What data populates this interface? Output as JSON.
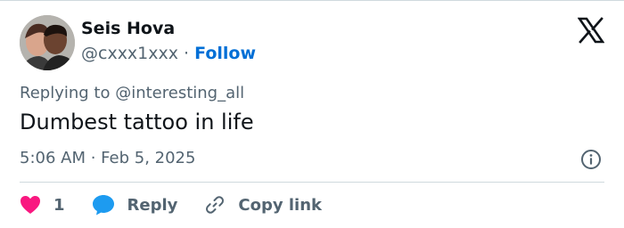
{
  "author": {
    "display_name": "Seis Hova",
    "handle": "@cxxx1xxx",
    "separator": "·",
    "follow_label": "Follow"
  },
  "replying": {
    "prefix": "Replying to",
    "target": "@interesting_all"
  },
  "tweet": {
    "text": "Dumbest tattoo in life",
    "timestamp": "5:06 AM · Feb 5, 2025"
  },
  "actions": {
    "like_count": "1",
    "reply_label": "Reply",
    "copy_link_label": "Copy link"
  },
  "icons": {
    "brand": "x-logo-icon",
    "info": "info-icon",
    "like": "heart-icon",
    "reply": "speech-bubble-icon",
    "copy": "link-icon"
  },
  "colors": {
    "link_blue": "#006fd6",
    "like_pink": "#f91880",
    "reply_blue": "#1d9bf0",
    "muted_text": "#536471",
    "primary_text": "#0f1419",
    "divider": "#cfd9de"
  }
}
